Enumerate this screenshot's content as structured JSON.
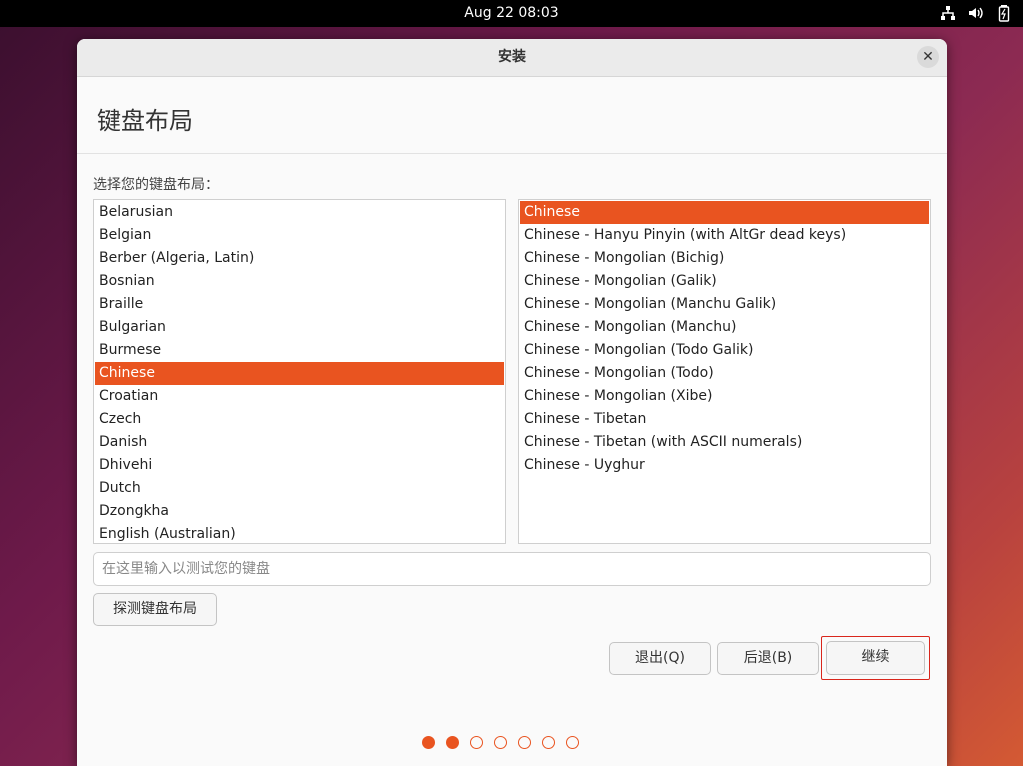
{
  "topbar": {
    "clock": "Aug 22  08:03",
    "icons": [
      "network-icon",
      "volume-icon",
      "battery-icon"
    ]
  },
  "window": {
    "title": "安装"
  },
  "page": {
    "title": "键盘布局",
    "prompt": "选择您的键盘布局："
  },
  "layouts": [
    "Belarusian",
    "Belgian",
    "Berber (Algeria, Latin)",
    "Bosnian",
    "Braille",
    "Bulgarian",
    "Burmese",
    "Chinese",
    "Croatian",
    "Czech",
    "Danish",
    "Dhivehi",
    "Dutch",
    "Dzongkha",
    "English (Australian)"
  ],
  "variants": [
    "Chinese",
    "Chinese - Hanyu Pinyin (with AltGr dead keys)",
    "Chinese - Mongolian (Bichig)",
    "Chinese - Mongolian (Galik)",
    "Chinese - Mongolian (Manchu Galik)",
    "Chinese - Mongolian (Manchu)",
    "Chinese - Mongolian (Todo Galik)",
    "Chinese - Mongolian (Todo)",
    "Chinese - Mongolian (Xibe)",
    "Chinese - Tibetan",
    "Chinese - Tibetan (with ASCII numerals)",
    "Chinese - Uyghur"
  ],
  "selected_layout": "Chinese",
  "selected_variant": "Chinese",
  "test_input": {
    "value": "",
    "placeholder": "在这里输入以测试您的键盘"
  },
  "buttons": {
    "detect": "探测键盘布局",
    "quit": "退出(Q)",
    "back": "后退(B)",
    "continue": "继续"
  },
  "progress": {
    "total": 7,
    "completed": 2
  },
  "colors": {
    "accent": "#e95420",
    "focus": "#d9261c"
  }
}
